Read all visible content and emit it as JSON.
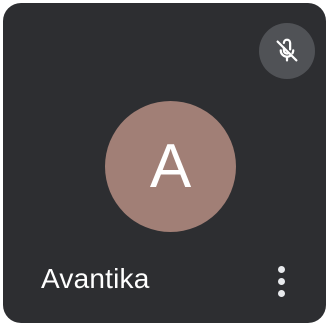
{
  "participant": {
    "name": "Avantika",
    "avatar_initial": "A",
    "avatar_color": "#a17f76",
    "mic_state": "muted",
    "mic_icon": "mic-off-icon",
    "more_icon": "more-vert-icon"
  },
  "colors": {
    "tile_background": "#2d2e31",
    "mute_badge_background": "#505256",
    "text": "#ffffff"
  }
}
